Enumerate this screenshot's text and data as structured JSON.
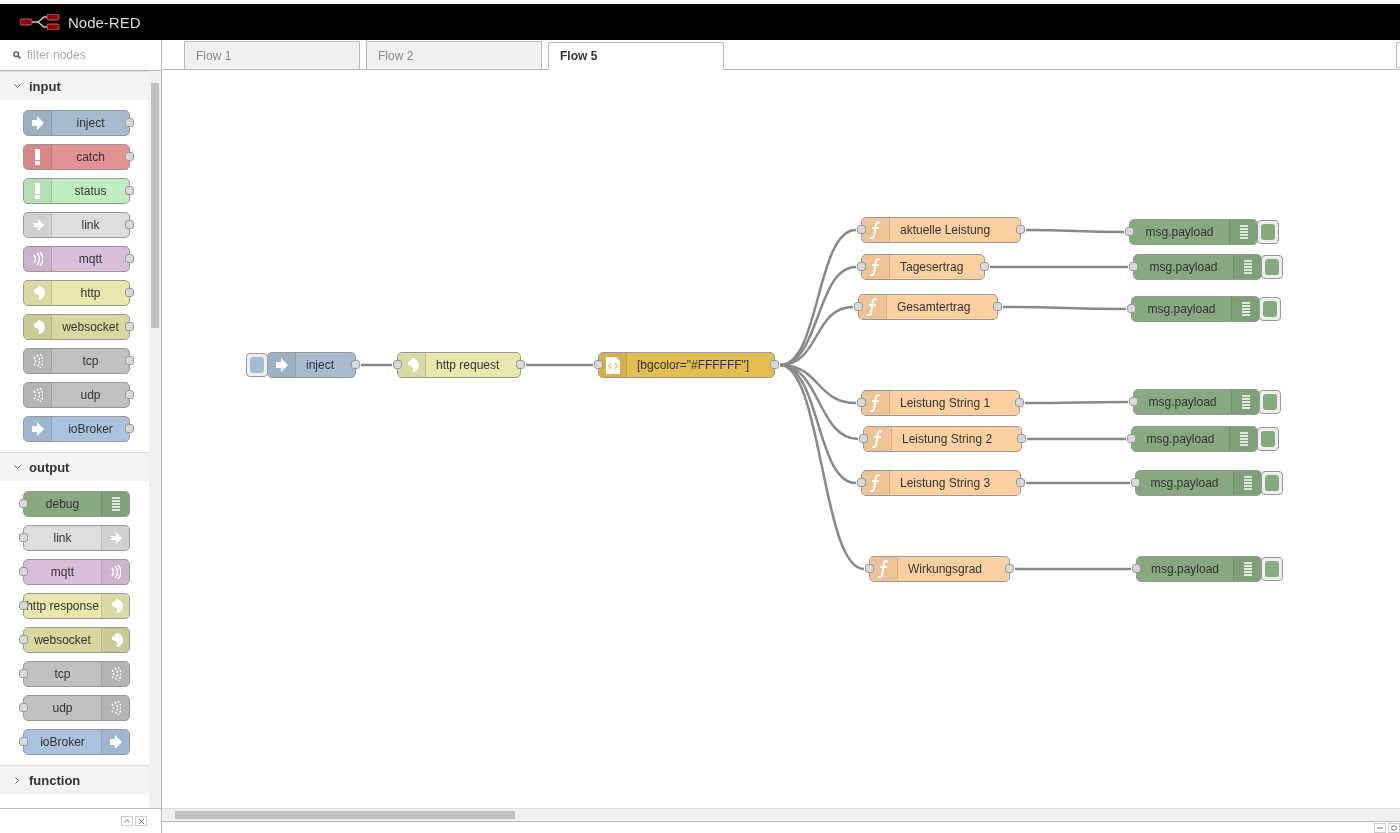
{
  "header": {
    "title": "Node-RED"
  },
  "palette": {
    "filter": {
      "placeholder": "filter nodes"
    },
    "categories": [
      {
        "name": "input",
        "expanded": true,
        "nodes": [
          {
            "label": "inject",
            "kind": "inject"
          },
          {
            "label": "catch",
            "kind": "catch"
          },
          {
            "label": "status",
            "kind": "status"
          },
          {
            "label": "link",
            "kind": "link"
          },
          {
            "label": "mqtt",
            "kind": "mqtt"
          },
          {
            "label": "http",
            "kind": "http"
          },
          {
            "label": "websocket",
            "kind": "websocket"
          },
          {
            "label": "tcp",
            "kind": "tcp"
          },
          {
            "label": "udp",
            "kind": "udp"
          },
          {
            "label": "ioBroker",
            "kind": "iobroker"
          }
        ]
      },
      {
        "name": "output",
        "expanded": true,
        "nodes": [
          {
            "label": "debug",
            "kind": "debug"
          },
          {
            "label": "link",
            "kind": "link"
          },
          {
            "label": "mqtt",
            "kind": "mqtt"
          },
          {
            "label": "http response",
            "kind": "http"
          },
          {
            "label": "websocket",
            "kind": "websocket"
          },
          {
            "label": "tcp",
            "kind": "tcp"
          },
          {
            "label": "udp",
            "kind": "udp"
          },
          {
            "label": "ioBroker",
            "kind": "iobroker"
          }
        ]
      },
      {
        "name": "function",
        "expanded": false
      }
    ]
  },
  "tabs": [
    {
      "label": "Flow 1",
      "selected": false
    },
    {
      "label": "Flow 2",
      "selected": false
    },
    {
      "label": "Flow 5",
      "selected": true
    }
  ],
  "flow": {
    "nodes": [
      {
        "label": "inject",
        "kind": "inject"
      },
      {
        "label": "http request",
        "kind": "http"
      },
      {
        "label": "[bgcolor=\"#FFFFFF\"]",
        "kind": "template"
      },
      {
        "label": "aktuelle Leistung",
        "kind": "function"
      },
      {
        "label": "Tagesertrag",
        "kind": "function"
      },
      {
        "label": "Gesamtertrag",
        "kind": "function"
      },
      {
        "label": "Leistung String 1",
        "kind": "function"
      },
      {
        "label": "Leistung String 2",
        "kind": "function"
      },
      {
        "label": "Leistung String 3",
        "kind": "function"
      },
      {
        "label": "Wirkungsgrad",
        "kind": "function"
      },
      {
        "label": "msg.payload",
        "kind": "debug"
      },
      {
        "label": "msg.payload",
        "kind": "debug"
      },
      {
        "label": "msg.payload",
        "kind": "debug"
      },
      {
        "label": "msg.payload",
        "kind": "debug"
      },
      {
        "label": "msg.payload",
        "kind": "debug"
      },
      {
        "label": "msg.payload",
        "kind": "debug"
      },
      {
        "label": "msg.payload",
        "kind": "debug"
      }
    ]
  }
}
